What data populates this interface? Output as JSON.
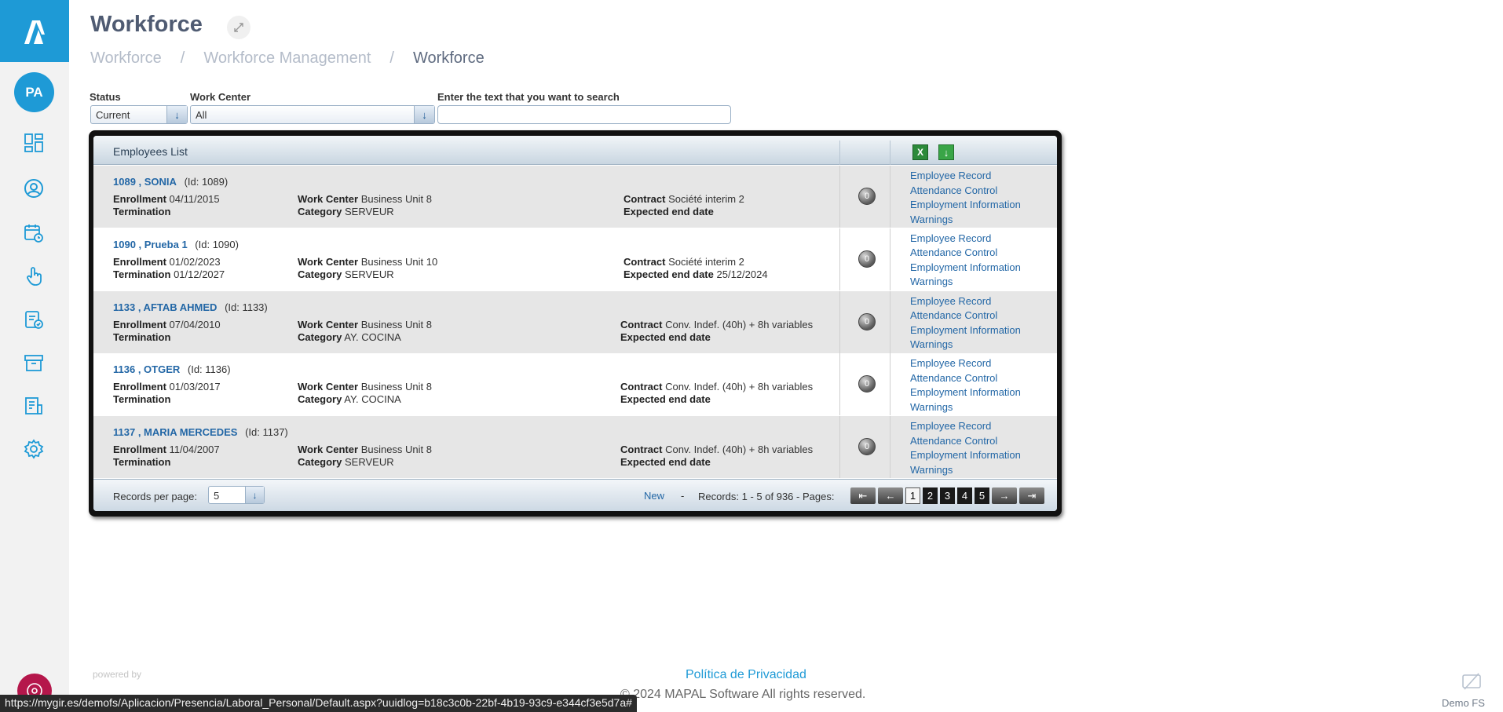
{
  "sidebar": {
    "avatar_initials": "PA",
    "icons": [
      "dashboard-icon",
      "user-circle-icon",
      "calendar-clock-icon",
      "hand-touch-icon",
      "report-check-icon",
      "archive-icon",
      "document-list-icon",
      "settings-icon"
    ],
    "accent": "#1e9ad6"
  },
  "header": {
    "title": "Workforce",
    "breadcrumb": [
      "Workforce",
      "Workforce Management",
      "Workforce"
    ]
  },
  "filters": {
    "status_label": "Status",
    "status_value": "Current",
    "workcenter_label": "Work Center",
    "workcenter_value": "All",
    "search_label": "Enter the text that you want to search",
    "search_value": ""
  },
  "grid": {
    "title": "Employees List",
    "labels": {
      "enrollment": "Enrollment",
      "termination": "Termination",
      "work_center": "Work Center",
      "category": "Category",
      "contract": "Contract",
      "expected_end": "Expected end date"
    },
    "links": [
      "Employee Record",
      "Attendance Control",
      "Employment Information",
      "Warnings"
    ],
    "rows": [
      {
        "name": "1089 , SONIA",
        "id": "(Id: 1089)",
        "enrollment": "04/11/2015",
        "termination": "",
        "work_center": "Business Unit 8",
        "category": "SERVEUR",
        "contract": "Société interim 2",
        "expected_end": ""
      },
      {
        "name": "1090 , Prueba 1",
        "id": "(Id: 1090)",
        "enrollment": "01/02/2023",
        "termination": "01/12/2027",
        "work_center": "Business Unit 10",
        "category": "SERVEUR",
        "contract": "Société interim 2",
        "expected_end": "25/12/2024"
      },
      {
        "name": "1133 , AFTAB AHMED",
        "id": "(Id: 1133)",
        "enrollment": "07/04/2010",
        "termination": "",
        "work_center": "Business Unit 8",
        "category": "AY. COCINA",
        "contract": "Conv. Indef. (40h) + 8h variables",
        "expected_end": ""
      },
      {
        "name": "1136 , OTGER",
        "id": "(Id: 1136)",
        "enrollment": "01/03/2017",
        "termination": "",
        "work_center": "Business Unit 8",
        "category": "AY. COCINA",
        "contract": "Conv. Indef. (40h) + 8h variables",
        "expected_end": ""
      },
      {
        "name": "1137 , MARIA MERCEDES",
        "id": "(Id: 1137)",
        "enrollment": "11/04/2007",
        "termination": "",
        "work_center": "Business Unit 8",
        "category": "SERVEUR",
        "contract": "Conv. Indef. (40h) + 8h variables",
        "expected_end": ""
      }
    ],
    "footer": {
      "records_per_page_label": "Records per page:",
      "records_per_page_value": "5",
      "new_label": "New",
      "dash": "-",
      "records_text": "Records: 1 - 5 of 936 - Pages:",
      "pages": [
        "1",
        "2",
        "3",
        "4",
        "5"
      ],
      "current_page": "1"
    }
  },
  "footer": {
    "powered_by": "powered by",
    "privacy": "Política de Privacidad",
    "copyright": "© 2024 MAPAL Software All rights reserved.",
    "demo_label": "Demo FS",
    "status_url": "https://mygir.es/demofs/Aplicacion/Presencia/Laboral_Personal/Default.aspx?uuidlog=b18c3c0b-22bf-4b19-93c9-e344cf3e5d7a#"
  }
}
